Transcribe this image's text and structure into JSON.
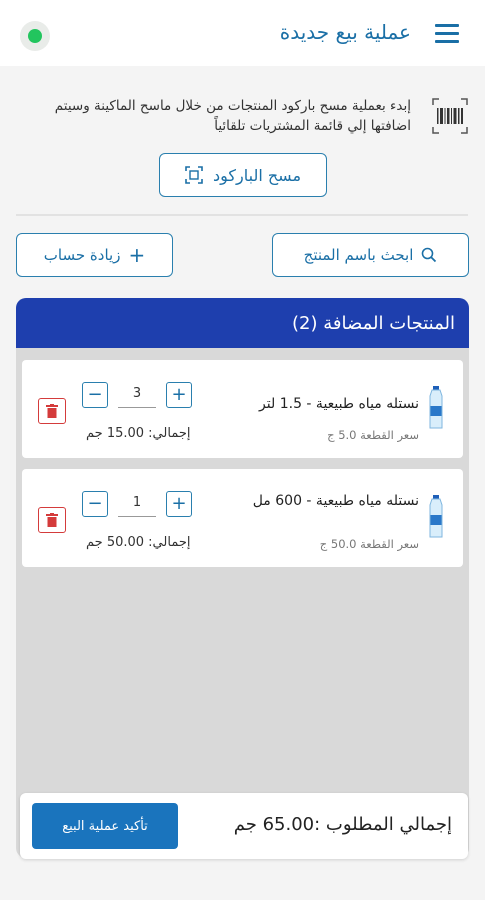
{
  "header": {
    "title": "عملية بيع جديدة",
    "menu_icon": "hamburger-menu-icon",
    "status_color": "#22c55e"
  },
  "scan_section": {
    "instructions": "إبدء بعملية مسح باركود المنتجات من خلال ماسح الماكينة وسيتم اضافتها إلي قائمة المشتريات تلقائياً",
    "scan_button_label": "مسح الباركود",
    "icon": "barcode-icon"
  },
  "actions": {
    "search_label": "ابحث باسم المنتج",
    "add_account_label": "زيادة حساب"
  },
  "cart": {
    "title": "المنتجات المضافة (2)",
    "header_color": "#1e3fae",
    "items": [
      {
        "name": "نستله مياه طبيعية - 1.5 لتر",
        "unit_price": "سعر القطعة 5.0 ج",
        "quantity": "3",
        "total": "إجمالي: 15.00 جم"
      },
      {
        "name": "نستله مياه طبيعية - 600 مل",
        "unit_price": "سعر القطعة 50.0 ج",
        "quantity": "1",
        "total": "إجمالي: 50.00 جم"
      }
    ]
  },
  "footer": {
    "grand_total": "إجمالي المطلوب :65.00 جم",
    "confirm_label": "تأكيد عملية البيع",
    "confirm_color": "#1a74bd"
  }
}
